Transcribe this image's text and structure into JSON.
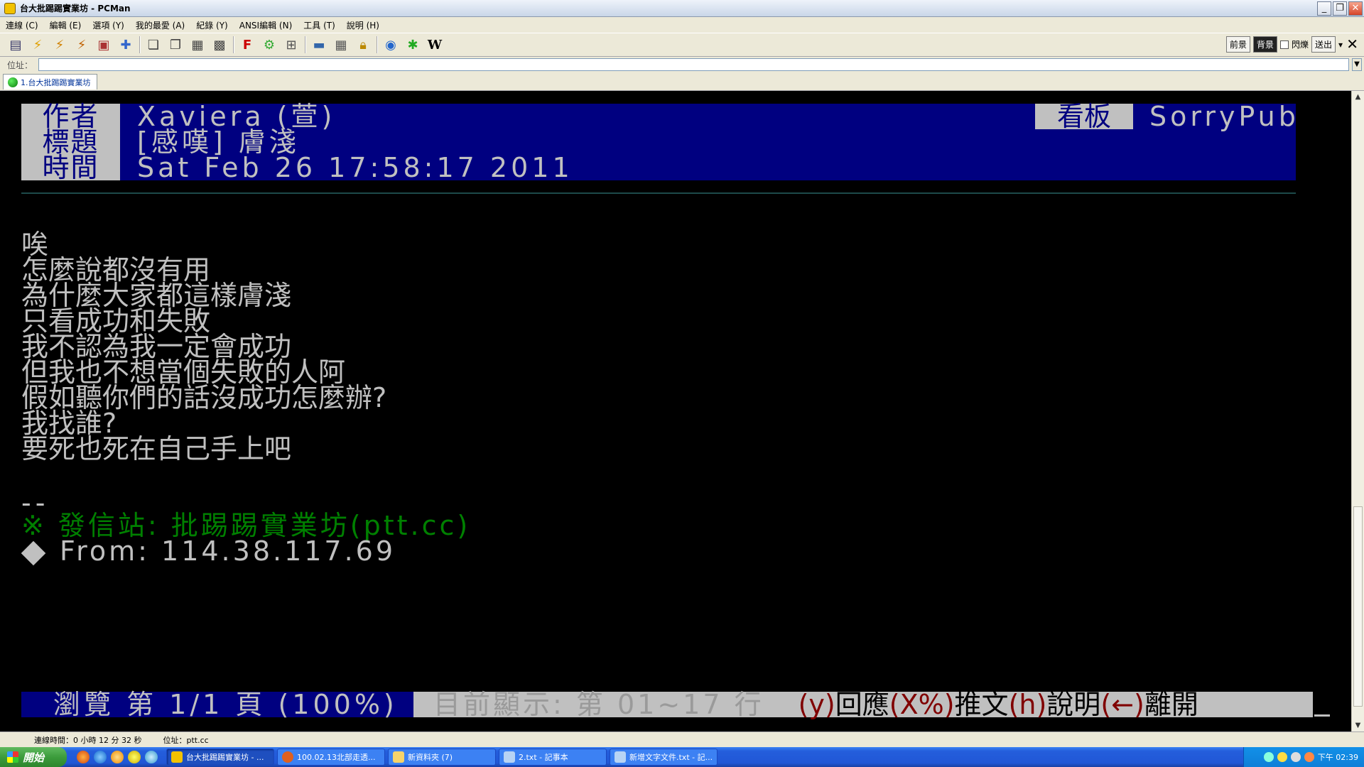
{
  "window": {
    "title": "台大批踢踢實業坊 - PCMan"
  },
  "menu": [
    "連線 (C)",
    "編輯 (E)",
    "選項 (Y)",
    "我的最愛 (A)",
    "紀錄 (Y)",
    "ANSI編輯 (N)",
    "工具 (T)",
    "說明 (H)"
  ],
  "toolbar_right": {
    "fg_label": "前景",
    "bg_label": "背景",
    "blink_label": "閃爍",
    "send_label": "送出"
  },
  "address": {
    "label": "位址：",
    "value": ""
  },
  "tab": {
    "label": "1.台大批踢踢實業坊"
  },
  "article": {
    "author_label": "作者",
    "title_label": "標題",
    "time_label": "時間",
    "board_label": "看板",
    "author": "Xaviera (萱)",
    "title": "[感嘆] 膚淺",
    "time": "Sat Feb 26 17:58:17 2011",
    "board": "SorryPub",
    "body": [
      "唉",
      "怎麼說都沒有用",
      "為什麼大家都這樣膚淺",
      "只看成功和失敗",
      "我不認為我一定會成功",
      "但我也不想當個失敗的人阿",
      "假如聽你們的話沒成功怎麼辦?",
      "我找誰?",
      "要死也死在自己手上吧"
    ],
    "sig_sep": "--",
    "sig_site": "※ 發信站: 批踢踢實業坊(ptt.cc)",
    "sig_from": "From: 114.38.117.69"
  },
  "footer": {
    "browse": "瀏覽 第 1/1 頁 (100%)",
    "showing": "目前顯示: 第 01~17 行",
    "k1": "(y)",
    "t1": "回應",
    "k2": "(X%)",
    "t2": "推文",
    "k3": "(h)",
    "t3": "說明",
    "k4": "(←)",
    "t4": "離開"
  },
  "statusbar": {
    "conn_time": "連線時間：0 小時 12 分 32 秒",
    "addr": "位址：ptt.cc"
  },
  "taskbar": {
    "start": "開始",
    "tasks": [
      "台大批踢踢實業坊 - ...",
      "100.02.13北部走透...",
      "新資料夾 (7)",
      "2.txt - 記事本",
      "新增文字文件.txt - 記..."
    ],
    "clock": "下午 02:39"
  },
  "colors": {
    "terminal_bg": "#000000",
    "header_blue": "#000080",
    "label_gray": "#c0c0c0",
    "signature_green": "#008000",
    "key_red": "#800000"
  }
}
